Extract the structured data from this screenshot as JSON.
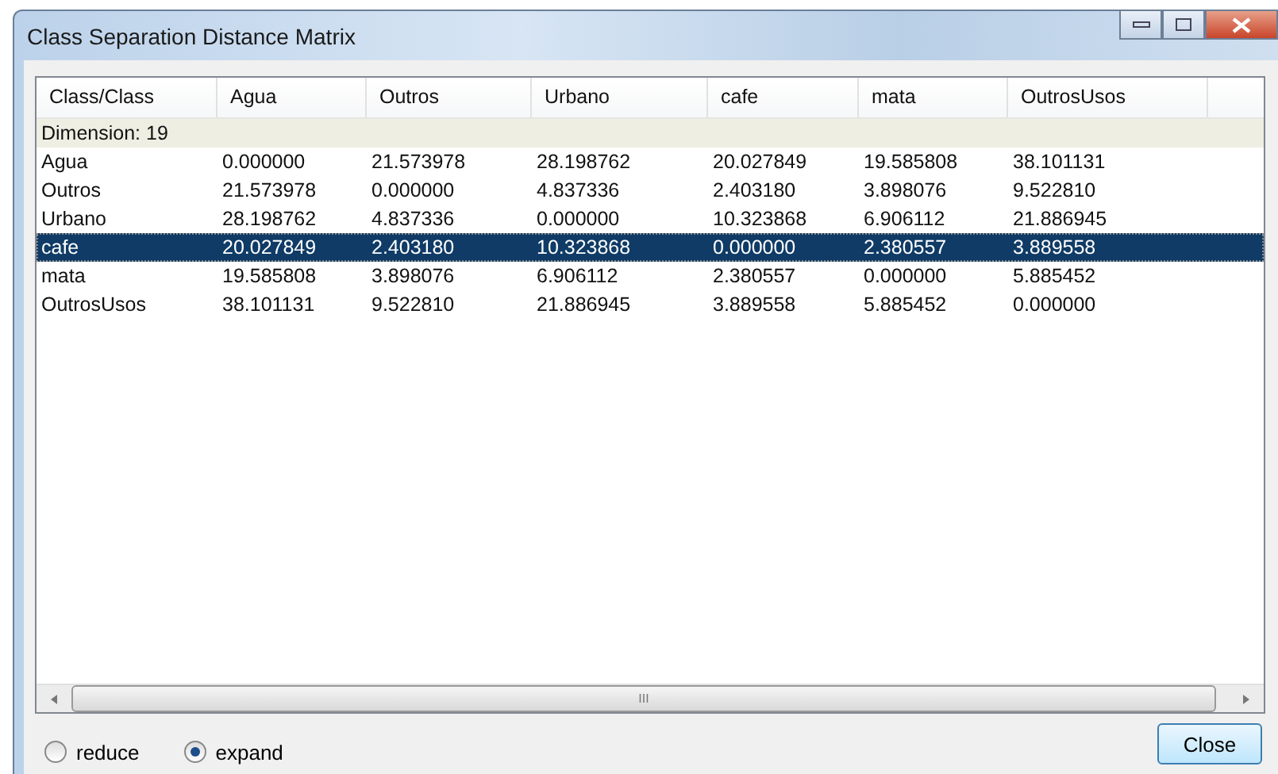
{
  "window": {
    "title": "Class Separation Distance Matrix"
  },
  "table": {
    "columns": [
      "Class/Class",
      "Agua",
      "Outros",
      "Urbano",
      "cafe",
      "mata",
      "OutrosUsos"
    ],
    "group_row": "Dimension: 19",
    "rows": [
      {
        "cells": [
          "Agua",
          "0.000000",
          "21.573978",
          "28.198762",
          "20.027849",
          "19.585808",
          "38.101131"
        ],
        "selected": false
      },
      {
        "cells": [
          "Outros",
          "21.573978",
          "0.000000",
          "4.837336",
          "2.403180",
          "3.898076",
          "9.522810"
        ],
        "selected": false
      },
      {
        "cells": [
          "Urbano",
          "28.198762",
          "4.837336",
          "0.000000",
          "10.323868",
          "6.906112",
          "21.886945"
        ],
        "selected": false
      },
      {
        "cells": [
          "cafe",
          "20.027849",
          "2.403180",
          "10.323868",
          "0.000000",
          "2.380557",
          "3.889558"
        ],
        "selected": true
      },
      {
        "cells": [
          "mata",
          "19.585808",
          "3.898076",
          "6.906112",
          "2.380557",
          "0.000000",
          "5.885452"
        ],
        "selected": false
      },
      {
        "cells": [
          "OutrosUsos",
          "38.101131",
          "9.522810",
          "21.886945",
          "3.889558",
          "5.885452",
          "0.000000"
        ],
        "selected": false
      }
    ]
  },
  "scroll_thumb": "III",
  "options": [
    {
      "label": "reduce",
      "selected": false
    },
    {
      "label": "expand",
      "selected": true
    }
  ],
  "buttons": [
    "Close"
  ]
}
